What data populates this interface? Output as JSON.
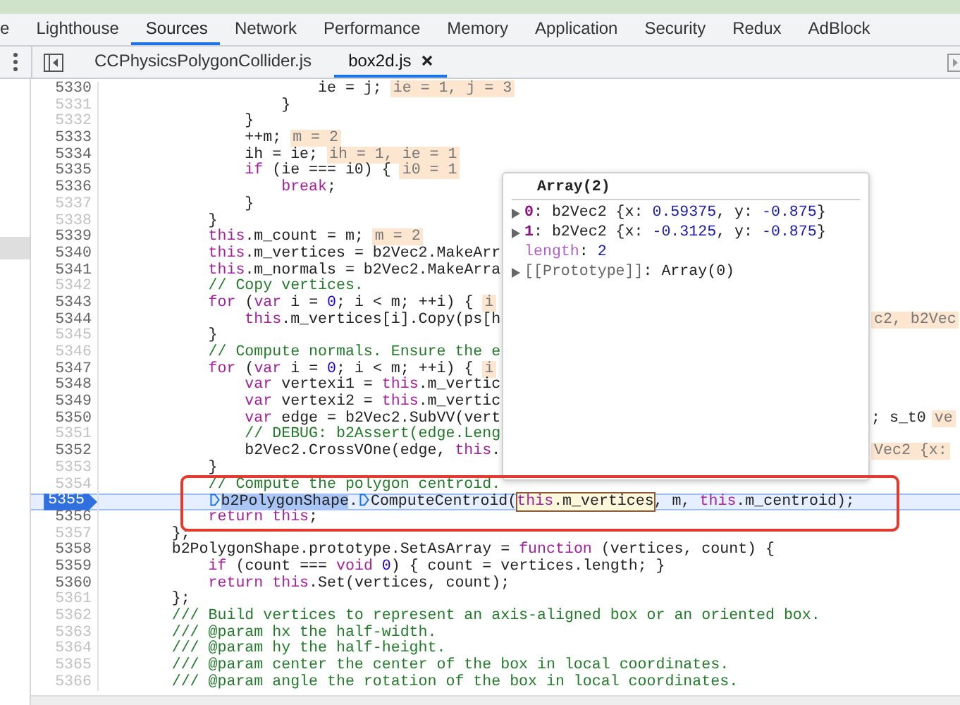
{
  "panel_tabs": [
    {
      "label": "e",
      "selected": false
    },
    {
      "label": "Lighthouse",
      "selected": false
    },
    {
      "label": "Sources",
      "selected": true
    },
    {
      "label": "Network",
      "selected": false
    },
    {
      "label": "Performance",
      "selected": false
    },
    {
      "label": "Memory",
      "selected": false
    },
    {
      "label": "Application",
      "selected": false
    },
    {
      "label": "Security",
      "selected": false
    },
    {
      "label": "Redux",
      "selected": false
    },
    {
      "label": "AdBlock",
      "selected": false
    }
  ],
  "file_tabs": [
    {
      "label": "CCPhysicsPolygonCollider.js",
      "selected": false
    },
    {
      "label": "box2d.js",
      "selected": true
    }
  ],
  "code_lines": [
    {
      "number": "5330",
      "executable": true,
      "current": false,
      "segments": [
        {
          "kind": "code",
          "tokens": [
            {
              "kind": "plain",
              "text": "                        ie = j;"
            }
          ]
        },
        {
          "kind": "chip",
          "text": "ie = 1, j = 3"
        }
      ]
    },
    {
      "number": "5331",
      "executable": false,
      "current": false,
      "segments": [
        {
          "kind": "code",
          "tokens": [
            {
              "kind": "plain",
              "text": "                    }"
            }
          ]
        }
      ]
    },
    {
      "number": "5332",
      "executable": false,
      "current": false,
      "segments": [
        {
          "kind": "code",
          "tokens": [
            {
              "kind": "plain",
              "text": "                }"
            }
          ]
        }
      ]
    },
    {
      "number": "5333",
      "executable": true,
      "current": false,
      "segments": [
        {
          "kind": "code",
          "tokens": [
            {
              "kind": "plain",
              "text": "                ++m;"
            }
          ]
        },
        {
          "kind": "chip",
          "text": "m = 2"
        }
      ]
    },
    {
      "number": "5334",
      "executable": true,
      "current": false,
      "segments": [
        {
          "kind": "code",
          "tokens": [
            {
              "kind": "plain",
              "text": "                ih = ie;"
            }
          ]
        },
        {
          "kind": "chip",
          "text": "ih = 1, ie = 1"
        }
      ]
    },
    {
      "number": "5335",
      "executable": true,
      "current": false,
      "segments": [
        {
          "kind": "code",
          "tokens": [
            {
              "kind": "keyword",
              "text": "                if"
            },
            {
              "kind": "plain",
              "text": " (ie === i0) {"
            }
          ]
        },
        {
          "kind": "chip",
          "text": "i0 = 1"
        }
      ]
    },
    {
      "number": "5336",
      "executable": true,
      "current": false,
      "segments": [
        {
          "kind": "code",
          "tokens": [
            {
              "kind": "keyword",
              "text": "                    break"
            },
            {
              "kind": "plain",
              "text": ";"
            }
          ]
        }
      ]
    },
    {
      "number": "5337",
      "executable": false,
      "current": false,
      "segments": [
        {
          "kind": "code",
          "tokens": [
            {
              "kind": "plain",
              "text": "                }"
            }
          ]
        }
      ]
    },
    {
      "number": "5338",
      "executable": false,
      "current": false,
      "segments": [
        {
          "kind": "code",
          "tokens": [
            {
              "kind": "plain",
              "text": "            }"
            }
          ]
        }
      ]
    },
    {
      "number": "5339",
      "executable": true,
      "current": false,
      "segments": [
        {
          "kind": "code",
          "tokens": [
            {
              "kind": "keyword",
              "text": "            this"
            },
            {
              "kind": "plain",
              "text": ".m_count = m;"
            }
          ]
        },
        {
          "kind": "chip",
          "text": "m = 2"
        }
      ]
    },
    {
      "number": "5340",
      "executable": true,
      "current": false,
      "segments": [
        {
          "kind": "code",
          "tokens": [
            {
              "kind": "keyword",
              "text": "            this"
            },
            {
              "kind": "plain",
              "text": ".m_vertices = b2Vec2.MakeArr"
            }
          ]
        }
      ]
    },
    {
      "number": "5341",
      "executable": true,
      "current": false,
      "segments": [
        {
          "kind": "code",
          "tokens": [
            {
              "kind": "keyword",
              "text": "            this"
            },
            {
              "kind": "plain",
              "text": ".m_normals = b2Vec2.MakeArra"
            }
          ]
        }
      ]
    },
    {
      "number": "5342",
      "executable": false,
      "current": false,
      "segments": [
        {
          "kind": "code",
          "tokens": [
            {
              "kind": "comment",
              "text": "            // Copy vertices."
            }
          ]
        }
      ]
    },
    {
      "number": "5343",
      "executable": true,
      "current": false,
      "segments": [
        {
          "kind": "code",
          "tokens": [
            {
              "kind": "keyword",
              "text": "            for"
            },
            {
              "kind": "plain",
              "text": " ("
            },
            {
              "kind": "keyword",
              "text": "var"
            },
            {
              "kind": "plain",
              "text": " i = "
            },
            {
              "kind": "number",
              "text": "0"
            },
            {
              "kind": "plain",
              "text": "; i < m; ++i) {"
            }
          ]
        },
        {
          "kind": "chip",
          "text": "i"
        }
      ]
    },
    {
      "number": "5344",
      "executable": true,
      "current": false,
      "segments": [
        {
          "kind": "code",
          "tokens": [
            {
              "kind": "keyword",
              "text": "                this"
            },
            {
              "kind": "plain",
              "text": ".m_vertices[i].Copy(ps[h"
            }
          ]
        }
      ],
      "right_segments": [
        {
          "kind": "chip",
          "text": "c2, b2Vec"
        }
      ]
    },
    {
      "number": "5345",
      "executable": false,
      "current": false,
      "segments": [
        {
          "kind": "code",
          "tokens": [
            {
              "kind": "plain",
              "text": "            }"
            }
          ]
        }
      ]
    },
    {
      "number": "5346",
      "executable": false,
      "current": false,
      "segments": [
        {
          "kind": "code",
          "tokens": [
            {
              "kind": "comment",
              "text": "            // Compute normals. Ensure the e"
            }
          ]
        }
      ]
    },
    {
      "number": "5347",
      "executable": true,
      "current": false,
      "segments": [
        {
          "kind": "code",
          "tokens": [
            {
              "kind": "keyword",
              "text": "            for"
            },
            {
              "kind": "plain",
              "text": " ("
            },
            {
              "kind": "keyword",
              "text": "var"
            },
            {
              "kind": "plain",
              "text": " i = "
            },
            {
              "kind": "number",
              "text": "0"
            },
            {
              "kind": "plain",
              "text": "; i < m; ++i) {"
            }
          ]
        },
        {
          "kind": "chip",
          "text": "i"
        }
      ]
    },
    {
      "number": "5348",
      "executable": true,
      "current": false,
      "segments": [
        {
          "kind": "code",
          "tokens": [
            {
              "kind": "keyword",
              "text": "                var"
            },
            {
              "kind": "plain",
              "text": " vertexi1 = "
            },
            {
              "kind": "keyword",
              "text": "this"
            },
            {
              "kind": "plain",
              "text": ".m_vertic"
            }
          ]
        }
      ]
    },
    {
      "number": "5349",
      "executable": true,
      "current": false,
      "segments": [
        {
          "kind": "code",
          "tokens": [
            {
              "kind": "keyword",
              "text": "                var"
            },
            {
              "kind": "plain",
              "text": " vertexi2 = "
            },
            {
              "kind": "keyword",
              "text": "this"
            },
            {
              "kind": "plain",
              "text": ".m_vertic"
            }
          ]
        }
      ]
    },
    {
      "number": "5350",
      "executable": true,
      "current": false,
      "segments": [
        {
          "kind": "code",
          "tokens": [
            {
              "kind": "keyword",
              "text": "                var"
            },
            {
              "kind": "plain",
              "text": " edge = b2Vec2.SubVV(vert"
            }
          ]
        }
      ],
      "right_segments": [
        {
          "kind": "code",
          "tokens": [
            {
              "kind": "plain",
              "text": "; s_t0"
            }
          ]
        },
        {
          "kind": "chip",
          "text": "ve"
        }
      ]
    },
    {
      "number": "5351",
      "executable": false,
      "current": false,
      "segments": [
        {
          "kind": "code",
          "tokens": [
            {
              "kind": "comment",
              "text": "                // DEBUG: b2Assert(edge.Leng"
            }
          ]
        }
      ]
    },
    {
      "number": "5352",
      "executable": true,
      "current": false,
      "segments": [
        {
          "kind": "code",
          "tokens": [
            {
              "kind": "plain",
              "text": "                b2Vec2.CrossVOne(edge, "
            },
            {
              "kind": "keyword",
              "text": "this"
            },
            {
              "kind": "plain",
              "text": "."
            }
          ]
        }
      ],
      "right_segments": [
        {
          "kind": "chip",
          "text": "Vec2 {x:"
        }
      ]
    },
    {
      "number": "5353",
      "executable": false,
      "current": false,
      "segments": [
        {
          "kind": "code",
          "tokens": [
            {
              "kind": "plain",
              "text": "            }"
            }
          ]
        }
      ]
    },
    {
      "number": "5354",
      "executable": false,
      "current": false,
      "segments": [
        {
          "kind": "code",
          "tokens": [
            {
              "kind": "comment",
              "text": "            // Compute the polygon centroid."
            }
          ]
        }
      ]
    },
    {
      "number": "5355",
      "executable": true,
      "current": true,
      "segments": [
        {
          "kind": "step"
        },
        {
          "kind": "paused",
          "tokens": [
            {
              "kind": "plain",
              "text": "            b2PolygonShape"
            }
          ]
        },
        {
          "kind": "code",
          "tokens": [
            {
              "kind": "plain",
              "text": "."
            }
          ]
        },
        {
          "kind": "step"
        },
        {
          "kind": "code",
          "tokens": [
            {
              "kind": "plain",
              "text": "ComputeCentroid("
            }
          ]
        },
        {
          "kind": "hovered",
          "tokens": [
            {
              "kind": "keyword",
              "text": "this"
            },
            {
              "kind": "plain",
              "text": ".m_vertices"
            }
          ]
        },
        {
          "kind": "code",
          "tokens": [
            {
              "kind": "plain",
              "text": ", m, "
            },
            {
              "kind": "keyword",
              "text": "this"
            },
            {
              "kind": "plain",
              "text": ".m_centroid);"
            }
          ]
        }
      ]
    },
    {
      "number": "5356",
      "executable": true,
      "current": false,
      "segments": [
        {
          "kind": "code",
          "tokens": [
            {
              "kind": "keyword",
              "text": "            return this"
            },
            {
              "kind": "plain",
              "text": ";"
            }
          ]
        }
      ]
    },
    {
      "number": "5357",
      "executable": false,
      "current": false,
      "segments": [
        {
          "kind": "code",
          "tokens": [
            {
              "kind": "plain",
              "text": "        };"
            }
          ]
        }
      ]
    },
    {
      "number": "5358",
      "executable": true,
      "current": false,
      "segments": [
        {
          "kind": "code",
          "tokens": [
            {
              "kind": "plain",
              "text": "        b2PolygonShape.prototype.SetAsArray = "
            },
            {
              "kind": "keyword",
              "text": "function"
            },
            {
              "kind": "plain",
              "text": " (vertices, count) {"
            }
          ]
        }
      ]
    },
    {
      "number": "5359",
      "executable": true,
      "current": false,
      "segments": [
        {
          "kind": "code",
          "tokens": [
            {
              "kind": "keyword",
              "text": "            if"
            },
            {
              "kind": "plain",
              "text": " (count === "
            },
            {
              "kind": "keyword",
              "text": "void "
            },
            {
              "kind": "number",
              "text": "0"
            },
            {
              "kind": "plain",
              "text": ") { count = vertices.length; }"
            }
          ]
        }
      ]
    },
    {
      "number": "5360",
      "executable": true,
      "current": false,
      "segments": [
        {
          "kind": "code",
          "tokens": [
            {
              "kind": "keyword",
              "text": "            return this"
            },
            {
              "kind": "plain",
              "text": ".Set(vertices, count);"
            }
          ]
        }
      ]
    },
    {
      "number": "5361",
      "executable": false,
      "current": false,
      "segments": [
        {
          "kind": "code",
          "tokens": [
            {
              "kind": "plain",
              "text": "        };"
            }
          ]
        }
      ]
    },
    {
      "number": "5362",
      "executable": false,
      "current": false,
      "segments": [
        {
          "kind": "code",
          "tokens": [
            {
              "kind": "comment",
              "text": "        /// Build vertices to represent an axis-aligned box or an oriented box."
            }
          ]
        }
      ]
    },
    {
      "number": "5363",
      "executable": false,
      "current": false,
      "segments": [
        {
          "kind": "code",
          "tokens": [
            {
              "kind": "comment",
              "text": "        /// @param hx the half-width."
            }
          ]
        }
      ]
    },
    {
      "number": "5364",
      "executable": false,
      "current": false,
      "segments": [
        {
          "kind": "code",
          "tokens": [
            {
              "kind": "comment",
              "text": "        /// @param hy the half-height."
            }
          ]
        }
      ]
    },
    {
      "number": "5365",
      "executable": false,
      "current": false,
      "segments": [
        {
          "kind": "code",
          "tokens": [
            {
              "kind": "comment",
              "text": "        /// @param center the center of the box in local coordinates."
            }
          ]
        }
      ]
    },
    {
      "number": "5366",
      "executable": false,
      "current": false,
      "segments": [
        {
          "kind": "code",
          "tokens": [
            {
              "kind": "comment",
              "text": "        /// @param angle the rotation of the box in local coordinates."
            }
          ]
        }
      ]
    }
  ],
  "tooltip": {
    "title": "Array(2)",
    "rows": [
      {
        "expandable": true,
        "tokens": [
          {
            "kind": "index",
            "text": "0"
          },
          {
            "kind": "plain",
            "text": ": b2Vec2 {x: "
          },
          {
            "kind": "number",
            "text": "0.59375"
          },
          {
            "kind": "plain",
            "text": ", y: "
          },
          {
            "kind": "number",
            "text": "-0.875"
          },
          {
            "kind": "plain",
            "text": "}"
          }
        ]
      },
      {
        "expandable": true,
        "tokens": [
          {
            "kind": "index",
            "text": "1"
          },
          {
            "kind": "plain",
            "text": ": b2Vec2 {x: "
          },
          {
            "kind": "number",
            "text": "-0.3125"
          },
          {
            "kind": "plain",
            "text": ", y: "
          },
          {
            "kind": "number",
            "text": "-0.875"
          },
          {
            "kind": "plain",
            "text": "}"
          }
        ]
      },
      {
        "expandable": false,
        "tokens": [
          {
            "kind": "prop",
            "text": "length"
          },
          {
            "kind": "plain",
            "text": ": "
          },
          {
            "kind": "number",
            "text": "2"
          }
        ]
      },
      {
        "expandable": true,
        "tokens": [
          {
            "kind": "internal",
            "text": "[[Prototype]]"
          },
          {
            "kind": "plain",
            "text": ": Array(0)"
          }
        ]
      }
    ]
  }
}
